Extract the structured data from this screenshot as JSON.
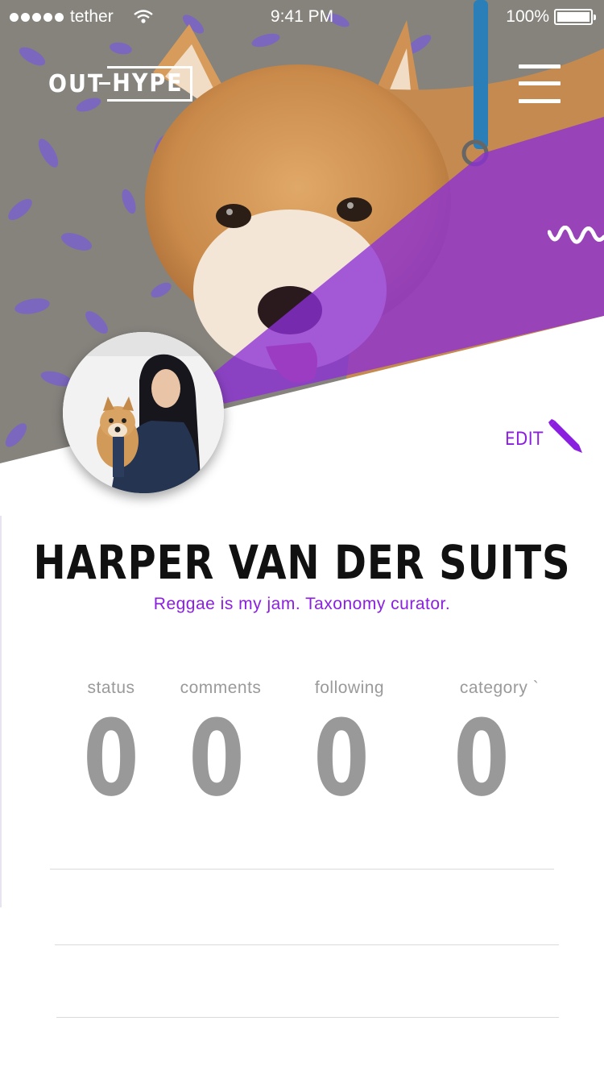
{
  "status_bar": {
    "carrier": "tether",
    "time": "9:41 PM",
    "battery": "100%"
  },
  "header": {
    "logo_part1": "OUT",
    "logo_part2": "HYPE"
  },
  "icons": {
    "menu": "hamburger-menu-icon",
    "wave": "wave-icon",
    "edit": "pencil-icon",
    "wifi": "wifi-icon",
    "battery": "battery-icon"
  },
  "profile": {
    "edit_label": "EDIT",
    "name": "HARPER VAN DER SUITS",
    "bio": "Reggae is my jam. Taxonomy curator."
  },
  "stats": [
    {
      "label": "status",
      "value": "0"
    },
    {
      "label": "comments",
      "value": "0"
    },
    {
      "label": "following",
      "value": "0"
    },
    {
      "label": "category `",
      "value": "0"
    }
  ],
  "colors": {
    "accent": "#8a1fe0",
    "overlay": "#8c2fd6",
    "stat_gray": "#999999"
  }
}
